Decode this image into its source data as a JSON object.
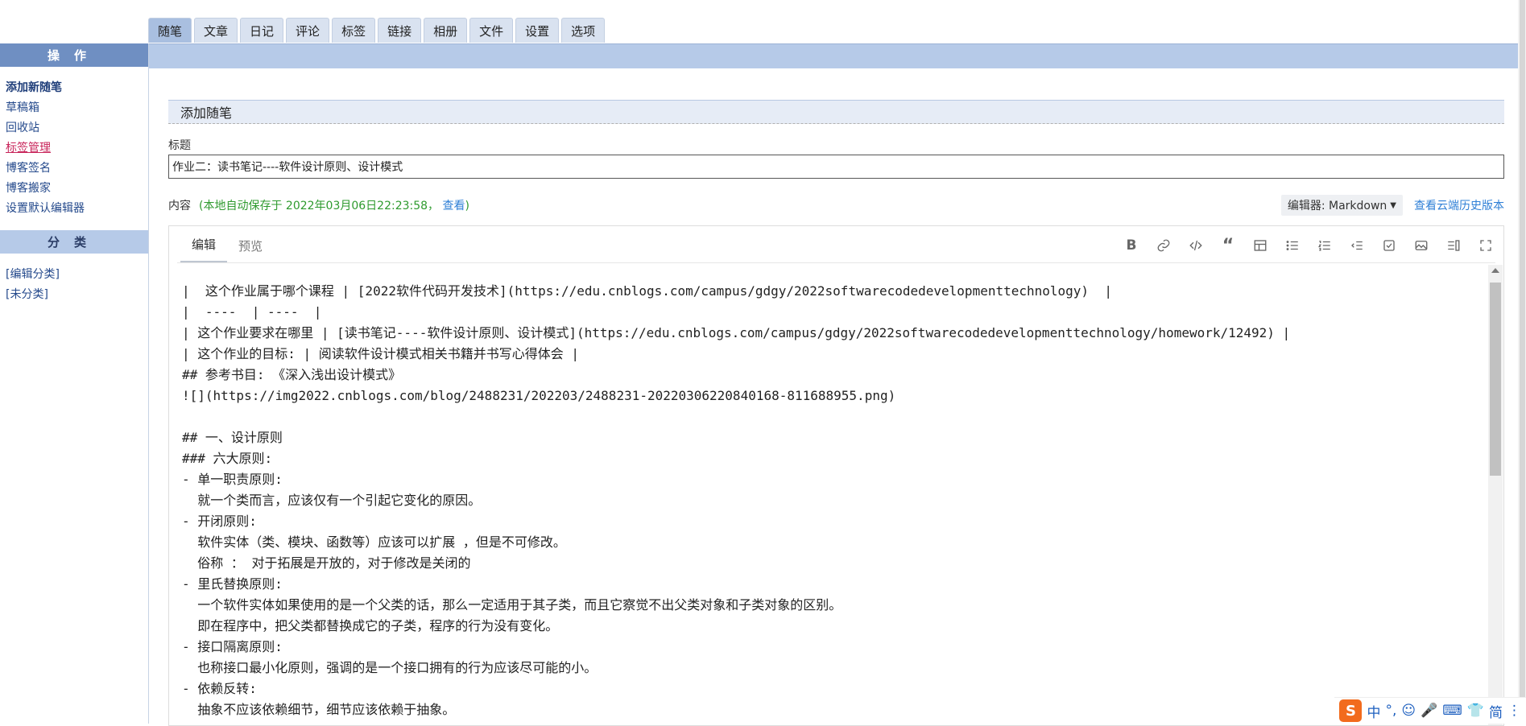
{
  "top_tabs": [
    "随笔",
    "文章",
    "日记",
    "评论",
    "标签",
    "链接",
    "相册",
    "文件",
    "设置",
    "选项"
  ],
  "sidebar": {
    "ops_title": "操作",
    "ops_items": [
      "添加新随笔",
      "草稿箱",
      "回收站",
      "标签管理",
      "博客签名",
      "博客搬家",
      "设置默认编辑器"
    ],
    "cat_title": "分类",
    "cat_items": [
      "[编辑分类]",
      "[未分类]"
    ]
  },
  "main": {
    "section_title": "添加随笔",
    "title_label": "标题",
    "title_value": "作业二：读书笔记----软件设计原则、设计模式",
    "content_label": "内容",
    "autosave_prefix": "(本地自动保存于 2022年03月06日22:23:58，",
    "autosave_link": "查看",
    "autosave_suffix": ")",
    "editor_select": "编辑器: Markdown",
    "history_link": "查看云端历史版本"
  },
  "editor": {
    "tabs": [
      "编辑",
      "预览"
    ],
    "toolbar_icons": [
      "bold-icon",
      "link-icon",
      "code-icon",
      "quote-icon",
      "table-icon",
      "bullet-list-icon",
      "numbered-list-icon",
      "indent-icon",
      "task-list-icon",
      "image-icon",
      "side-by-side-icon",
      "fullscreen-icon"
    ],
    "lines": [
      "|  这个作业属于哪个课程 | [2022软件代码开发技术](https://edu.cnblogs.com/campus/gdgy/2022softwarecodedevelopmenttechnology)  |",
      "|  ----  | ----  |",
      "| 这个作业要求在哪里 | [读书笔记----软件设计原则、设计模式](https://edu.cnblogs.com/campus/gdgy/2022softwarecodedevelopmenttechnology/homework/12492) |",
      "| 这个作业的目标: | 阅读软件设计模式相关书籍并书写心得体会 |",
      "## 参考书目: 《深入浅出设计模式》",
      "![](https://img2022.cnblogs.com/blog/2488231/202203/2488231-20220306220840168-811688955.png)",
      "",
      "## 一、设计原则",
      "### 六大原则:",
      "- 单一职责原则:",
      "  就一个类而言，应该仅有一个引起它变化的原因。",
      "- 开闭原则:",
      "  软件实体（类、模块、函数等）应该可以扩展 ，但是不可修改。",
      "  俗称 ： 对于拓展是开放的，对于修改是关闭的",
      "- 里氏替换原则:",
      "  一个软件实体如果使用的是一个父类的话，那么一定适用于其子类，而且它察觉不出父类对象和子类对象的区别。",
      "  即在程序中，把父类都替换成它的子类，程序的行为没有变化。",
      "- 接口隔离原则:",
      "  也称接口最小化原则，强调的是一个接口拥有的行为应该尽可能的小。",
      "- 依赖反转:",
      "  抽象不应该依赖细节，细节应该依赖于抽象。"
    ]
  },
  "ime": {
    "logo": "S",
    "items": [
      "中",
      "°,",
      "☺",
      "🎤",
      "⌨",
      "👕",
      "简",
      "⋮"
    ]
  }
}
